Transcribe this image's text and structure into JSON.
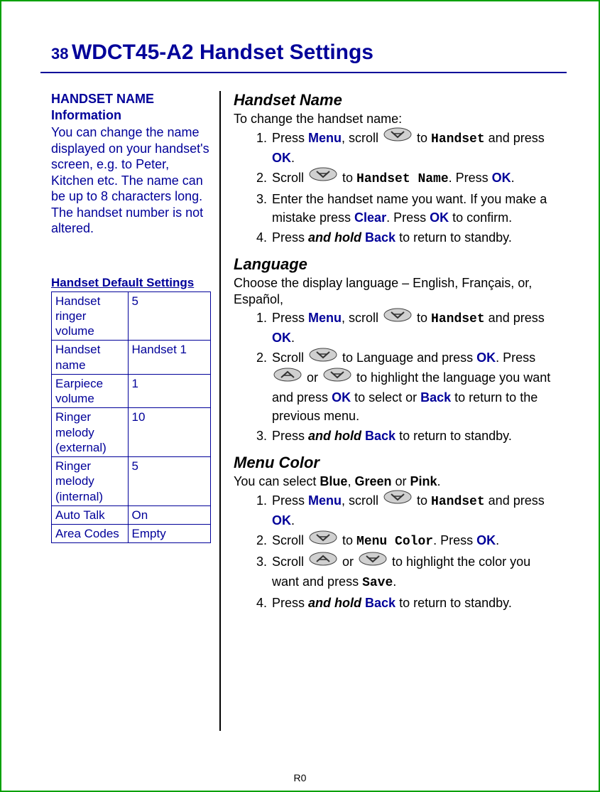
{
  "header": {
    "page_number": "38",
    "title": "WDCT45-A2 Handset Settings"
  },
  "sidebar": {
    "info_head_line1": "HANDSET NAME",
    "info_head_line2": "Information",
    "info_body": "You can change the name displayed on your handset's screen, e.g. to Peter, Kitchen etc.  The name can be up to 8 characters long.  The handset number is not altered.",
    "table_title": "Handset Default Settings",
    "rows": [
      {
        "label": "Handset ringer volume",
        "value": "5"
      },
      {
        "label": "Handset name",
        "value": "Handset 1"
      },
      {
        "label": "Earpiece volume",
        "value": "1"
      },
      {
        "label": "Ringer melody (external)",
        "value": "10"
      },
      {
        "label": "Ringer melody (internal)",
        "value": "5"
      },
      {
        "label": "Auto Talk",
        "value": "On"
      },
      {
        "label": "Area Codes",
        "value": "Empty"
      }
    ]
  },
  "sections": {
    "handset_name": {
      "heading": "Handset Name",
      "intro": "To change the handset name:",
      "s1a": "Press ",
      "s1_menu": "Menu",
      "s1b": ", scroll ",
      "s1c": " to ",
      "s1_handset": "Handset",
      "s1d": " and press ",
      "s1_ok": "OK",
      "s1e": ".",
      "s2a": "Scroll ",
      "s2b": " to ",
      "s2_hn": "Handset Name",
      "s2c": ".  Press ",
      "s2_ok": "OK",
      "s2d": ".",
      "s3a": "Enter the handset name you want. If you make a mistake press ",
      "s3_clear": "Clear",
      "s3b": ".  Press ",
      "s3_ok": "OK",
      "s3c": " to confirm.",
      "s4a": "Press ",
      "s4_hold": "and hold",
      "s4b": " ",
      "s4_back": "Back",
      "s4c": " to return to standby."
    },
    "language": {
      "heading": "Language",
      "intro": "Choose the display language – English, Français, or, Español,",
      "s1a": "Press ",
      "s1_menu": "Menu",
      "s1b": ", scroll ",
      "s1c": " to ",
      "s1_handset": "Handset",
      "s1d": " and press ",
      "s1_ok": "OK",
      "s1e": ".",
      "s2a": "Scroll ",
      "s2b": " to Language and press ",
      "s2_ok": "OK",
      "s2c": ". Press ",
      "s2d": " or ",
      "s2e": " to highlight the language you want and press ",
      "s2_ok2": "OK",
      "s2f": " to select or ",
      "s2_back": "Back",
      "s2g": " to return to the previous menu.",
      "s3a": "Press ",
      "s3_hold": "and hold",
      "s3b": " ",
      "s3_back": "Back",
      "s3c": " to return to standby."
    },
    "menu_color": {
      "heading": "Menu Color",
      "intro_a": "You can select ",
      "intro_blue": "Blue",
      "intro_b": ", ",
      "intro_green": "Green",
      "intro_c": " or ",
      "intro_pink": "Pink",
      "intro_d": ".",
      "s1a": "Press ",
      "s1_menu": "Menu",
      "s1b": ", scroll ",
      "s1c": " to ",
      "s1_handset": "Handset",
      "s1d": " and press ",
      "s1_ok": "OK",
      "s1e": ".",
      "s2a": "Scroll ",
      "s2b": " to ",
      "s2_mc": "Menu Color",
      "s2c": ".  Press ",
      "s2_ok": "OK",
      "s2d": ".",
      "s3a": "Scroll ",
      "s3b": " or ",
      "s3c": " to highlight the color you want and press ",
      "s3_save": "Save",
      "s3d": ".",
      "s4a": "Press ",
      "s4_hold": "and hold",
      "s4b": " ",
      "s4_back": "Back",
      "s4c": " to return to standby."
    }
  },
  "footer": "R0"
}
